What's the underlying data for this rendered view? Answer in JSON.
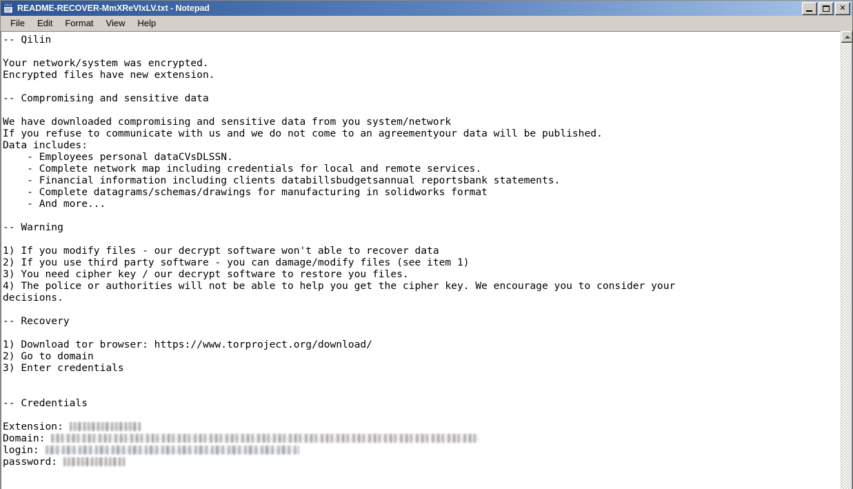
{
  "window": {
    "title": "README-RECOVER-MmXReVIxLV.txt - Notepad",
    "icon": "notepad-icon",
    "controls": {
      "minimize": "_",
      "maximize": "□",
      "close": "✕"
    }
  },
  "menubar": {
    "items": [
      {
        "label": "File"
      },
      {
        "label": "Edit"
      },
      {
        "label": "Format"
      },
      {
        "label": "View"
      },
      {
        "label": "Help"
      }
    ]
  },
  "scrollbar": {
    "up_arrow": "scroll-up-arrow",
    "position_percent": 0
  },
  "document": {
    "lines": [
      "-- Qilin",
      "",
      "Your network/system was encrypted.",
      "Encrypted files have new extension.",
      "",
      "-- Compromising and sensitive data",
      "",
      "We have downloaded compromising and sensitive data from you system/network",
      "If you refuse to communicate with us and we do not come to an agreementyour data will be published.",
      "Data includes:",
      "    - Employees personal dataCVsDLSSN.",
      "    - Complete network map including credentials for local and remote services.",
      "    - Financial information including clients databillsbudgetsannual reportsbank statements.",
      "    - Complete datagrams/schemas/drawings for manufacturing in solidworks format",
      "    - And more...",
      "",
      "-- Warning",
      "",
      "1) If you modify files - our decrypt software won't able to recover data",
      "2) If you use third party software - you can damage/modify files (see item 1)",
      "3) You need cipher key / our decrypt software to restore you files.",
      "4) The police or authorities will not be able to help you get the cipher key. We encourage you to consider your",
      "decisions.",
      "",
      "-- Recovery",
      "",
      "1) Download tor browser: https://www.torproject.org/download/",
      "2) Go to domain",
      "3) Enter credentials",
      "",
      "",
      "-- Credentials",
      ""
    ],
    "credentials": [
      {
        "label": "Extension: ",
        "redacted": true,
        "redact_width": 103,
        "redact_style": "r1"
      },
      {
        "label": "Domain: ",
        "redacted": true,
        "redact_width": 620,
        "redact_style": "r2"
      },
      {
        "label": "login: ",
        "redacted": true,
        "redact_width": 368,
        "redact_style": "r3"
      },
      {
        "label": "password: ",
        "redacted": true,
        "redact_width": 90,
        "redact_style": "r1"
      }
    ]
  },
  "colors": {
    "titlebar_start": "#2a5699",
    "titlebar_end": "#a9c6ea",
    "chrome": "#d4d0c8",
    "text": "#000000",
    "page": "#ffffff"
  }
}
